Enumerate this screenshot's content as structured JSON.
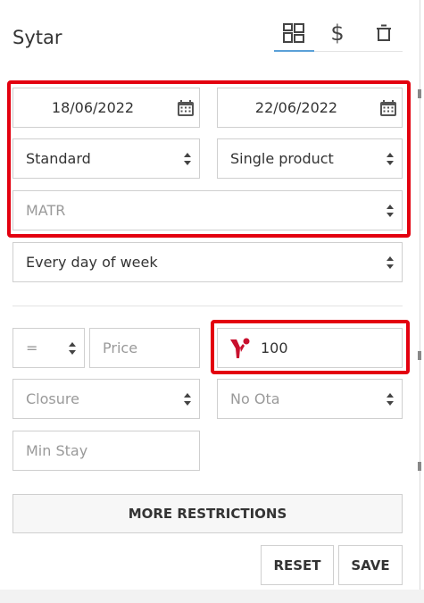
{
  "header": {
    "title": "Sytar",
    "icons": [
      "grid-view-icon",
      "dollar-icon",
      "trash-icon"
    ],
    "dollar_symbol": "$"
  },
  "dates": {
    "start": "18/06/2022",
    "end": "22/06/2022"
  },
  "selects": {
    "rate_type": "Standard",
    "product_type": "Single product",
    "rate_code_placeholder": "MATR",
    "days": "Every day of week",
    "operator": "=",
    "closure_placeholder": "Closure",
    "ota_placeholder": "No Ota"
  },
  "inputs": {
    "price_placeholder": "Price",
    "value": "100",
    "min_stay_placeholder": "Min Stay"
  },
  "buttons": {
    "more_restrictions": "MORE RESTRICTIONS",
    "reset": "RESET",
    "save": "SAVE"
  },
  "colors": {
    "highlight": "#e3000f",
    "tab_active": "#5aa0d8",
    "brand_logo": "#c8102e"
  }
}
